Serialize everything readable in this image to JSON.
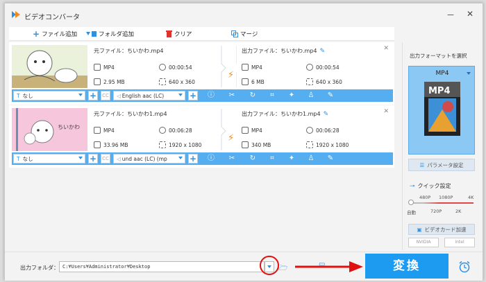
{
  "window": {
    "title": "ビデオコンバータ",
    "minimize": "－",
    "close": "✕"
  },
  "toolbar": {
    "add_file": "ファイル追加",
    "add_folder": "フォルダ追加",
    "clear": "クリア",
    "merge": "マージ"
  },
  "items": [
    {
      "source_name": "元ファイル：ちいかわ.mp4",
      "output_name": "出力ファイル：ちいかわ.mp4",
      "src": {
        "format": "MP4",
        "duration": "00:00:54",
        "size": "2.95 MB",
        "resolution": "640 x 360"
      },
      "out": {
        "format": "MP4",
        "duration": "00:00:54",
        "size": "6 MB",
        "resolution": "640 x 360"
      },
      "subtitle": "なし",
      "audio": "English aac (LC)"
    },
    {
      "source_name": "元ファイル：ちいかわ1.mp4",
      "output_name": "出力ファイル：ちいかわ1.mp4",
      "src": {
        "format": "MP4",
        "duration": "00:06:28",
        "size": "33.96 MB",
        "resolution": "1920 x 1080"
      },
      "out": {
        "format": "MP4",
        "duration": "00:06:28",
        "size": "340 MB",
        "resolution": "1920 x 1080"
      },
      "subtitle": "なし",
      "audio": "und aac (LC) (mp",
      "thumb_text": "ちいかわ"
    }
  ],
  "cc_label": "CC",
  "right_panel": {
    "format_label": "出力フォーマットを選択",
    "format": "MP4",
    "format_image_text": "MP4",
    "param_button": "パラメータ設定",
    "quick_label": "クイック設定",
    "ticks_top": [
      "480P",
      "1080P",
      "4K"
    ],
    "ticks_bottom": [
      "自動",
      "720P",
      "2K"
    ],
    "gpu_button": "ビデオカード加速",
    "badges": [
      "NVIDIA",
      "Intel"
    ]
  },
  "bottom": {
    "output_label": "出力フォルダ：",
    "output_path": "C:¥Users¥Administrator¥Desktop",
    "convert_button": "変換"
  },
  "colors": {
    "accent": "#1c9bf0",
    "bar": "#55aef0",
    "highlight": "#e01010",
    "bolt": "#f28b1d"
  }
}
